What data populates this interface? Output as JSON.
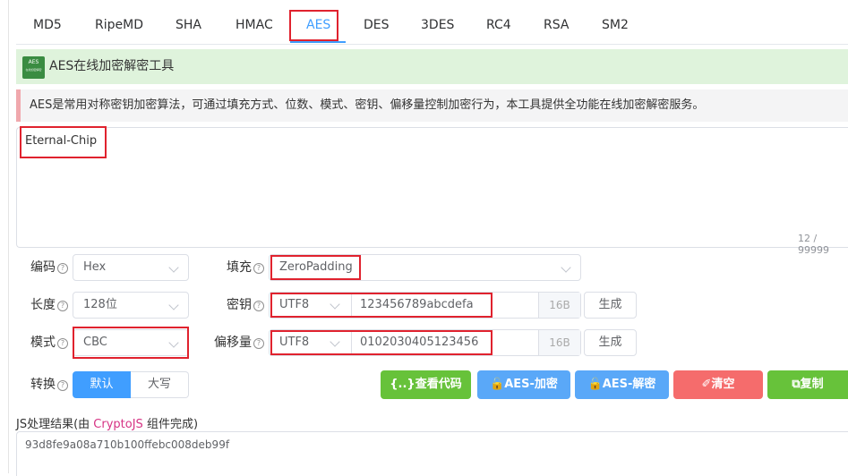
{
  "tabs": [
    {
      "label": "MD5"
    },
    {
      "label": "RipeMD"
    },
    {
      "label": "SHA"
    },
    {
      "label": "HMAC"
    },
    {
      "label": "AES"
    },
    {
      "label": "DES"
    },
    {
      "label": "3DES"
    },
    {
      "label": "RC4"
    },
    {
      "label": "RSA"
    },
    {
      "label": "SM2"
    }
  ],
  "active_tab": "AES",
  "header": {
    "logo_text": "AES",
    "logo_subtext": "在线加密解密",
    "title": "AES在线加密解密工具"
  },
  "description": "AES是常用对称密钥加密算法，可通过填充方式、位数、模式、密钥、偏移量控制加密行为，本工具提供全功能在线加密解密服务。",
  "input": {
    "value": "Eternal-Chip",
    "counter": "12 / 99999"
  },
  "form": {
    "encoding": {
      "label": "编码",
      "value": "Hex"
    },
    "length": {
      "label": "长度",
      "value": "128位"
    },
    "mode": {
      "label": "模式",
      "value": "CBC"
    },
    "convert": {
      "label": "转换",
      "options": [
        "默认",
        "大写"
      ],
      "selected": "默认"
    },
    "padding": {
      "label": "填充",
      "value": "ZeroPadding"
    },
    "key": {
      "label": "密钥",
      "charset": "UTF8",
      "value": "123456789abcdefa",
      "suffix": "16B",
      "generate": "生成"
    },
    "iv": {
      "label": "偏移量",
      "charset": "UTF8",
      "value": "0102030405123456",
      "suffix": "16B",
      "generate": "生成"
    },
    "help_glyph": "?"
  },
  "actions": {
    "view_code": "查看代码",
    "encrypt": "AES-加密",
    "decrypt": "AES-解密",
    "clear": "清空",
    "copy": "复制",
    "view_code_icon": "{..}",
    "encrypt_icon": "🔓",
    "decrypt_icon": "🔓",
    "clear_icon": "✐",
    "copy_icon": "⧉"
  },
  "result": {
    "label_prefix": "JS处理结果(由 ",
    "label_lib": "CryptoJS",
    "label_suffix": " 组件完成)",
    "value": "93d8fe9a08a710b100ffebc008deb99f"
  },
  "colors": {
    "primary": "#409eff",
    "success": "#67c23a",
    "danger": "#f56c6c",
    "highlight": "#e0222e",
    "banner_bg": "#dff3dc"
  }
}
